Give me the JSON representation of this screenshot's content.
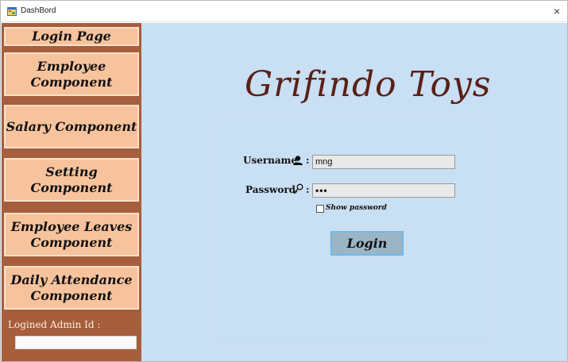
{
  "window": {
    "title": "DashBord",
    "close_glyph": "×"
  },
  "sidebar": {
    "items": [
      {
        "label_line1": "Login Page",
        "label_line2": ""
      },
      {
        "label_line1": "Employee",
        "label_line2": "Component"
      },
      {
        "label_line1": "Salary Component",
        "label_line2": ""
      },
      {
        "label_line1": "Setting Component",
        "label_line2": ""
      },
      {
        "label_line1": "Employee Leaves",
        "label_line2": "Component"
      },
      {
        "label_line1": "Daily Attendance",
        "label_line2": "Component"
      }
    ],
    "admin_label": "Logined Admin Id :",
    "admin_value": ""
  },
  "main": {
    "brand": "Grifindo Toys",
    "username_label": "Username",
    "username_value": "mng",
    "password_label": "Password",
    "password_value": "•••",
    "colon": ":",
    "show_password_label": "Show password",
    "show_password_checked": false,
    "login_label": "Login"
  },
  "icons": {
    "app": "app-icon",
    "user": "user-icon",
    "key": "key-icon"
  },
  "colors": {
    "sidebar_bg": "#a65e3d",
    "nav_button_bg": "#f7c39d",
    "main_bg": "#c8dff4",
    "brand_text": "#5a2015",
    "login_button_bg": "#9cb5c4"
  }
}
